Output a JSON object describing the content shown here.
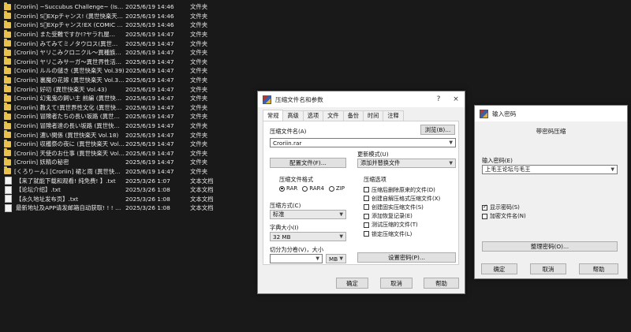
{
  "files": [
    {
      "name": "[Croriin] ~Succubus Challenge~ (Isek…",
      "date": "2025/6/19 14:46",
      "type": "文件夹",
      "icon": "folder-icon"
    },
    {
      "name": "[Croriin] S゚EXpチャンス! (異世快楽天…",
      "date": "2025/6/19 14:46",
      "type": "文件夹",
      "icon": "folder-icon"
    },
    {
      "name": "[Croriin] S゚EXpチャンス!EX (COMIC …",
      "date": "2025/6/19 14:46",
      "type": "文件夹",
      "icon": "folder-icon"
    },
    {
      "name": "[Croriin] また受難ですか!?ヤラれ屋…",
      "date": "2025/6/19 14:47",
      "type": "文件夹",
      "icon": "folder-icon"
    },
    {
      "name": "[Croriin] みてみてミノタウロス(異世…",
      "date": "2025/6/19 14:47",
      "type": "文件夹",
      "icon": "folder-icon"
    },
    {
      "name": "[Croriin] ヤリこみクロニクル～異種族…",
      "date": "2025/6/19 14:47",
      "type": "文件夹",
      "icon": "folder-icon"
    },
    {
      "name": "[Croriin] ヤリこみサーガ～異世界性活…",
      "date": "2025/6/19 14:47",
      "type": "文件夹",
      "icon": "folder-icon"
    },
    {
      "name": "[Croriin] ルルの儲き (異世快楽天 Vol.39)",
      "date": "2025/6/19 14:47",
      "type": "文件夹",
      "icon": "folder-icon"
    },
    {
      "name": "[Croriin] 裏魔の花嫁 (異世快楽天 Vol.3…",
      "date": "2025/6/19 14:47",
      "type": "文件夹",
      "icon": "folder-icon"
    },
    {
      "name": "[Croriin] 好叨 (異世快楽天 Vol.43)",
      "date": "2025/6/19 14:47",
      "type": "文件夹",
      "icon": "folder-icon"
    },
    {
      "name": "[Croriin] 幻鬼鬼の飼い主 前編 (異世快…",
      "date": "2025/6/19 14:47",
      "type": "文件夹",
      "icon": "folder-icon"
    },
    {
      "name": "[Croriin] 教えて!異世界性文化 (異世快…",
      "date": "2025/6/19 14:47",
      "type": "文件夹",
      "icon": "folder-icon"
    },
    {
      "name": "[Croriin] 冒険者たちの長い坂路 (異世快…",
      "date": "2025/6/19 14:47",
      "type": "文件夹",
      "icon": "folder-icon"
    },
    {
      "name": "[Croriin] 冒険者達の長い坂路 (異世快…",
      "date": "2025/6/19 14:47",
      "type": "文件夹",
      "icon": "folder-icon"
    },
    {
      "name": "[Croriin] 濃い関係 (異世快楽天 Vol.18)",
      "date": "2025/6/19 14:47",
      "type": "文件夹",
      "icon": "folder-icon"
    },
    {
      "name": "[Croriin] 収穫祭の夜に (異世快楽天 Vol…",
      "date": "2025/6/19 14:47",
      "type": "文件夹",
      "icon": "folder-icon"
    },
    {
      "name": "[Croriin] 天使のお仕事 (異世快楽天 Vol…",
      "date": "2025/6/19 14:47",
      "type": "文件夹",
      "icon": "folder-icon"
    },
    {
      "name": "[Croriin] 妖精の秘密",
      "date": "2025/6/19 14:47",
      "type": "文件夹",
      "icon": "folder-icon"
    },
    {
      "name": "[くろりーん] [Croriin] 裙と雨 (異世快楽…",
      "date": "2025/6/19 14:47",
      "type": "文件夹",
      "icon": "folder-icon"
    },
    {
      "name": "【来了就能下载和观看! 纯免费! 】.txt",
      "date": "2025/3/26 1:07",
      "type": "文本文档",
      "icon": "text-file-icon"
    },
    {
      "name": "【论坛介绍】.txt",
      "date": "2025/3/26 1:08",
      "type": "文本文档",
      "icon": "text-file-icon"
    },
    {
      "name": "【永久地址发布页】.txt",
      "date": "2025/3/26 1:08",
      "type": "文本文档",
      "icon": "text-file-icon"
    },
    {
      "name": "最新地址及APP请发邮箱自动获取! ! ! …",
      "date": "2025/3/26 1:08",
      "type": "文本文档",
      "icon": "text-file-icon"
    }
  ],
  "archive_dialog": {
    "title": "压缩文件名和参数",
    "help_glyph": "?",
    "close_glyph": "×",
    "tabs": [
      "常规",
      "高级",
      "选项",
      "文件",
      "备份",
      "时间",
      "注释"
    ],
    "archive_name_label": "压缩文件名(A)",
    "browse_button": "浏览(B)...",
    "archive_name_value": "Croriin.rar",
    "update_mode_label": "更新模式(U)",
    "update_mode_value": "添加并替换文件",
    "profiles_button": "配置文件(F)...",
    "format_group": "压缩文件格式",
    "formats": [
      {
        "label": "RAR",
        "selected": true
      },
      {
        "label": "RAR4",
        "selected": false
      },
      {
        "label": "ZIP",
        "selected": false
      }
    ],
    "method_label": "压缩方式(C)",
    "method_value": "标准",
    "dict_label": "字典大小(I)",
    "dict_value": "32 MB",
    "split_label": "切分为分卷(V)，大小",
    "split_value": "",
    "split_unit": "MB",
    "set_password_button": "设置密码(P)...",
    "options_group": "压缩选项",
    "options": [
      {
        "label": "压缩后删除原来的文件(D)",
        "checked": false
      },
      {
        "label": "创建自解压格式压缩文件(X)",
        "checked": false
      },
      {
        "label": "创建固实压缩文件(S)",
        "checked": false
      },
      {
        "label": "添加恢复记录(E)",
        "checked": false
      },
      {
        "label": "测试压缩的文件(T)",
        "checked": false
      },
      {
        "label": "锁定压缩文件(L)",
        "checked": false
      }
    ],
    "ok_button": "确定",
    "cancel_button": "取消",
    "help_button": "帮助"
  },
  "password_dialog": {
    "title": "输入密码",
    "header": "带密码压缩",
    "password_label": "输入密码(E)",
    "password_value": "上毛王论坛与毛王",
    "show_password": {
      "label": "显示密码(S)",
      "checked": true
    },
    "encrypt_names": {
      "label": "加密文件名(N)",
      "checked": false
    },
    "organize_button": "整理密码(O)...",
    "ok_button": "确定",
    "cancel_button": "取消",
    "help_button": "帮助"
  }
}
